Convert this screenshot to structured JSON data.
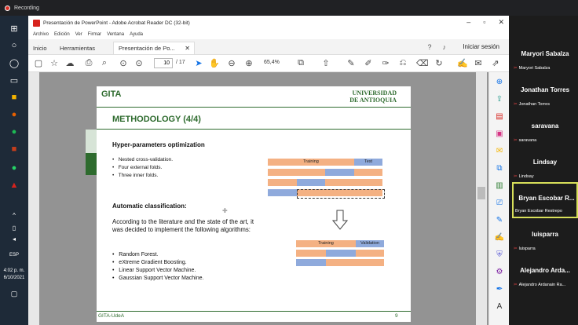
{
  "recording": {
    "label": "Recording"
  },
  "window": {
    "title": "Presentación de PowerPoint - Adobe Acrobat Reader DC (32-bit)",
    "menu": [
      "Archivo",
      "Edición",
      "Ver",
      "Firmar",
      "Ventana",
      "Ayuda"
    ],
    "tabs": {
      "home": "Inicio",
      "tools": "Herramientas",
      "doc": "Presentación de Po..."
    },
    "signin": "Iniciar sesión",
    "page_current": "10",
    "page_total": "/ 17",
    "zoom": "65,4%"
  },
  "taskbar": {
    "lang": "ESP",
    "time": "4:02 p. m.",
    "date": "6/10/2021"
  },
  "slide": {
    "logo": "GITA",
    "university": [
      "UNIVERSIDAD",
      "DE ANTIOQUIA"
    ],
    "title": "METHODOLOGY (4/4)",
    "h1": "Hyper-parameters optimization",
    "bullets1": [
      "Nested cross-validation.",
      "Four external folds.",
      "Three inner folds."
    ],
    "h2": "Automatic classification:",
    "paragraph": "According to the literature and the state of the art, it was decided to implement the following algorithms:",
    "bullets2": [
      "Random Forest.",
      "eXtreme Gradient Boosting.",
      "Linear Support Vector Machine.",
      "Gaussian Support Vector Machine."
    ],
    "outer_labels": {
      "train": "Training",
      "test": "Test"
    },
    "inner_labels": {
      "train": "Training",
      "val": "Validation"
    },
    "footer": "GITA-UdeA",
    "page": "9",
    "colors": {
      "train": "#f4b183",
      "test": "#8faadc",
      "brand": "#2e6b2e"
    }
  },
  "participants": [
    {
      "name": "Maryori Sabalza",
      "sub": "Maryori Sabalza"
    },
    {
      "name": "Jonathan Torres",
      "sub": "Jonathan Torres"
    },
    {
      "name": "saravana",
      "sub": "saravana"
    },
    {
      "name": "Lindsay",
      "sub": "Lindsay"
    },
    {
      "name": "Bryan Escobar R...",
      "sub": "Bryan Escobar Restrepo"
    },
    {
      "name": "luisparra",
      "sub": "luisparra"
    },
    {
      "name": "Alejandro Arda...",
      "sub": "Alejandro Ardanain Ra..."
    }
  ]
}
